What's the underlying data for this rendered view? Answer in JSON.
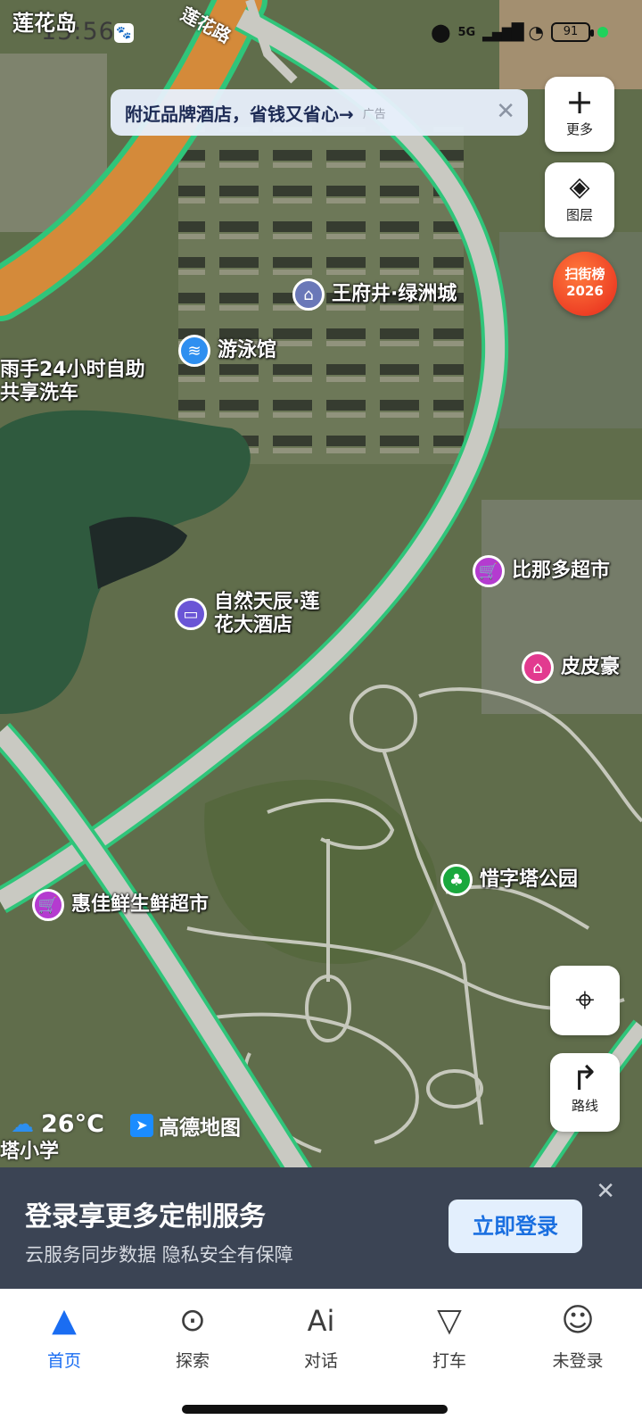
{
  "status_bar": {
    "time": "15:56",
    "location_name": "莲花岛",
    "network": "5G",
    "battery": "91"
  },
  "map": {
    "road_label": "莲花路",
    "ad_banner": {
      "text": "附近品牌酒店，省钱又省心→",
      "tag": "广告"
    },
    "controls": {
      "more": {
        "icon": "plus-icon",
        "label": "更多"
      },
      "layers": {
        "icon": "layers-icon",
        "label": "图层"
      },
      "street_badge": {
        "line1": "扫街榜",
        "line2": "2026"
      },
      "locate": {
        "icon": "locate-icon"
      },
      "route": {
        "icon": "route-icon",
        "label": "路线"
      }
    },
    "pois": [
      {
        "name": "王府井·绿洲城",
        "type": "residential",
        "color": "#6a78b8"
      },
      {
        "name": "游泳馆",
        "type": "swimming",
        "color": "#2e8ff0"
      },
      {
        "name": "雨手24小时自助共享洗车",
        "type": "carwash",
        "color": ""
      },
      {
        "name": "比那多超市",
        "type": "supermarket",
        "color": "#b43bd0"
      },
      {
        "name": "自然天辰·莲花大酒店",
        "type": "hotel",
        "color": "#6a55d6"
      },
      {
        "name": "皮皮豪",
        "type": "shop",
        "color": "#e23a8f"
      },
      {
        "name": "惜字塔公园",
        "type": "park",
        "color": "#1aa83d"
      },
      {
        "name": "惠佳鲜生鲜超市",
        "type": "supermarket",
        "color": "#b43bd0"
      },
      {
        "name": "塔小学",
        "type": "school",
        "color": ""
      }
    ],
    "weather": {
      "temp": "26°C",
      "icon": "cloud-icon"
    },
    "brand": "高德地图"
  },
  "login_prompt": {
    "title": "登录享更多定制服务",
    "subtitle": "云服务同步数据 隐私安全有保障",
    "button": "立即登录"
  },
  "tabs": [
    {
      "label": "首页",
      "icon": "navigation-arrow-icon",
      "active": true
    },
    {
      "label": "探索",
      "icon": "location-pin-icon",
      "active": false
    },
    {
      "label": "对话",
      "icon": "ai-icon",
      "active": false
    },
    {
      "label": "打车",
      "icon": "taxi-icon",
      "active": false
    },
    {
      "label": "未登录",
      "icon": "user-icon",
      "active": false
    }
  ]
}
